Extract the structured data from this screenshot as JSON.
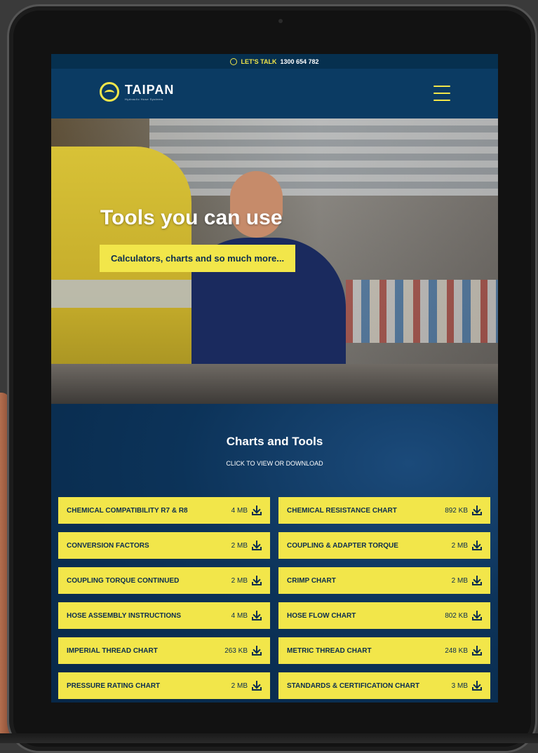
{
  "topbar": {
    "talk_label": "LET'S TALK",
    "phone": "1300 654 782"
  },
  "brand": {
    "name": "TAIPAN",
    "tagline": "Hydraulic Hose Systems"
  },
  "hero": {
    "title": "Tools you can use",
    "button_label": "Calculators, charts and so much more..."
  },
  "tools": {
    "title": "Charts and Tools",
    "subtitle": "CLICK TO VIEW OR DOWNLOAD",
    "items": [
      {
        "name": "CHEMICAL COMPATIBILITY R7 & R8",
        "size": "4 MB"
      },
      {
        "name": "CHEMICAL RESISTANCE CHART",
        "size": "892 KB"
      },
      {
        "name": "CONVERSION FACTORS",
        "size": "2 MB"
      },
      {
        "name": "COUPLING & ADAPTER TORQUE",
        "size": "2 MB"
      },
      {
        "name": "COUPLING TORQUE CONTINUED",
        "size": "2 MB"
      },
      {
        "name": "CRIMP CHART",
        "size": "2 MB"
      },
      {
        "name": "HOSE ASSEMBLY INSTRUCTIONS",
        "size": "4 MB"
      },
      {
        "name": "HOSE FLOW CHART",
        "size": "802 KB"
      },
      {
        "name": "IMPERIAL THREAD CHART",
        "size": "263 KB"
      },
      {
        "name": "METRIC THREAD CHART",
        "size": "248 KB"
      },
      {
        "name": "PRESSURE RATING CHART",
        "size": "2 MB"
      },
      {
        "name": "STANDARDS & CERTIFICATION CHART",
        "size": "3 MB"
      }
    ]
  },
  "colors": {
    "accent": "#f2e64a",
    "navy": "#0b3b63",
    "dark_navy": "#06304f"
  },
  "icons": [
    "chat-icon",
    "menu-icon",
    "download-icon"
  ]
}
